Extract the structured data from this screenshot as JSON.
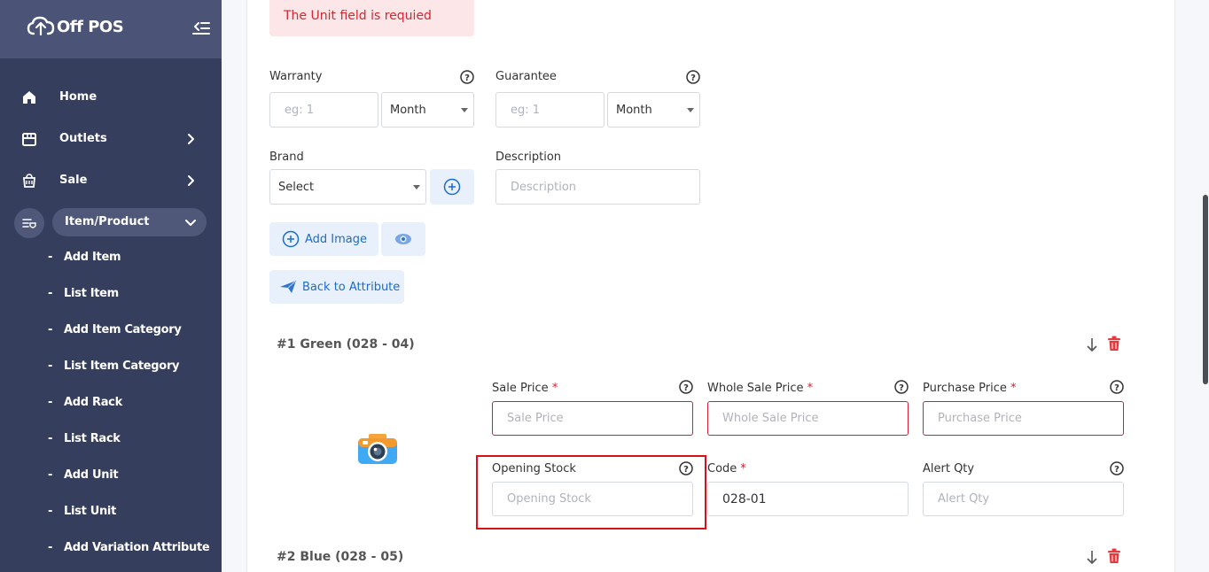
{
  "app": {
    "name": "Off POS"
  },
  "sidebar": {
    "menu": [
      {
        "label": "Home",
        "icon": "home-icon"
      },
      {
        "label": "Outlets",
        "icon": "store-icon"
      },
      {
        "label": "Sale",
        "icon": "cart-icon"
      },
      {
        "label": "Item/Product",
        "icon": "product-list-icon"
      }
    ],
    "submenu": [
      "Add Item",
      "List Item",
      "Add Item Category",
      "List Item Category",
      "Add Rack",
      "List Rack",
      "Add Unit",
      "List Unit",
      "Add Variation Attribute"
    ]
  },
  "form": {
    "alert": "The Unit field is requied",
    "warranty": {
      "label": "Warranty",
      "placeholder": "eg: 1",
      "unit": "Month"
    },
    "guarantee": {
      "label": "Guarantee",
      "placeholder": "eg: 1",
      "unit": "Month"
    },
    "brand": {
      "label": "Brand",
      "value": "Select"
    },
    "description": {
      "label": "Description",
      "placeholder": "Description"
    },
    "add_image": "Add Image",
    "back_to_attribute": "Back to Attribute"
  },
  "variants": [
    {
      "title": "#1 Green (028 - 04)",
      "sale_price": {
        "label": "Sale Price",
        "placeholder": "Sale Price"
      },
      "whole_sale_price": {
        "label": "Whole Sale Price",
        "placeholder": "Whole Sale Price"
      },
      "purchase_price": {
        "label": "Purchase Price",
        "placeholder": "Purchase Price"
      },
      "opening_stock": {
        "label": "Opening Stock",
        "placeholder": "Opening Stock"
      },
      "code": {
        "label": "Code",
        "value": "028-01"
      },
      "alert_qty": {
        "label": "Alert Qty",
        "placeholder": "Alert Qty"
      }
    },
    {
      "title": "#2 Blue (028 - 05)"
    }
  ],
  "required_mark": "*",
  "colors": {
    "sidebar": "#363e5e",
    "accent": "#1a6ccd",
    "error": "#d32030"
  }
}
